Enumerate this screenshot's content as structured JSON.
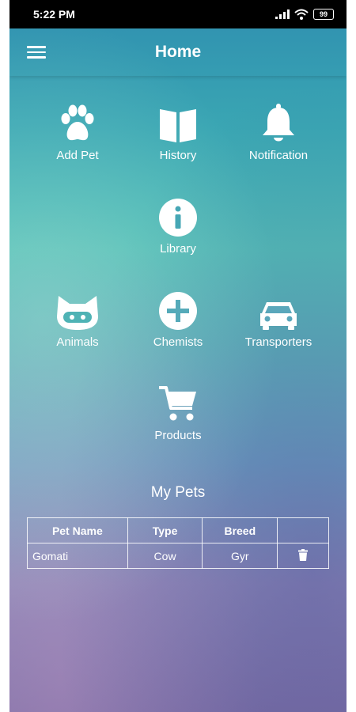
{
  "status_bar": {
    "time": "5:22 PM",
    "battery": "99"
  },
  "app_bar": {
    "title": "Home"
  },
  "tiles": {
    "add_pet": {
      "label": "Add Pet",
      "icon": "paw-icon"
    },
    "history": {
      "label": "History",
      "icon": "book-icon"
    },
    "notification": {
      "label": "Notification",
      "icon": "bell-icon"
    },
    "library": {
      "label": "Library",
      "icon": "info-icon"
    },
    "animals": {
      "label": "Animals",
      "icon": "cat-face-icon"
    },
    "chemists": {
      "label": "Chemists",
      "icon": "plus-circle-icon"
    },
    "transporters": {
      "label": "Transporters",
      "icon": "car-icon"
    },
    "products": {
      "label": "Products",
      "icon": "shopping-cart-icon"
    }
  },
  "my_pets": {
    "title": "My Pets",
    "columns": [
      "Pet Name",
      "Type",
      "Breed",
      ""
    ],
    "rows": [
      {
        "name": "Gomati",
        "type": "Cow",
        "breed": "Gyr",
        "action_icon": "trash-icon"
      }
    ]
  },
  "colors": {
    "text": "#ffffff",
    "status_bar": "#000000"
  }
}
